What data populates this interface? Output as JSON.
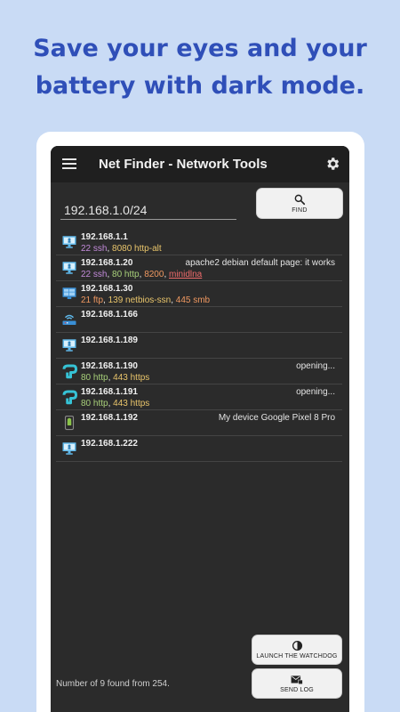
{
  "promo": {
    "line1": "Save your eyes and your",
    "line2": "battery with dark mode."
  },
  "appbar": {
    "title": "Net Finder - Network Tools",
    "menu_icon": "hamburger-menu-icon",
    "settings_icon": "gear-icon"
  },
  "search": {
    "value": "192.168.1.0/24",
    "find_label": "FIND",
    "find_icon": "search-icon"
  },
  "devices": [
    {
      "ip": "192.168.1.1",
      "icon": "monitor-icon",
      "ports": [
        [
          "22 ssh",
          "purple"
        ],
        [
          "8080 http-alt",
          "yellow"
        ]
      ],
      "note": ""
    },
    {
      "ip": "192.168.1.20",
      "icon": "monitor-icon",
      "ports": [
        [
          "22 ssh",
          "purple"
        ],
        [
          "80 http",
          "green"
        ],
        [
          "8200",
          "orange"
        ],
        [
          "minidlna",
          "red"
        ]
      ],
      "note": "apache2 debian default page: it works"
    },
    {
      "ip": "192.168.1.30",
      "icon": "windows-icon",
      "ports": [
        [
          "21 ftp",
          "orange"
        ],
        [
          "139 netbios-ssn",
          "yellow"
        ],
        [
          "445 smb",
          "orange"
        ]
      ],
      "note": ""
    },
    {
      "ip": "192.168.1.166",
      "icon": "router-icon",
      "ports": [],
      "note": ""
    },
    {
      "ip": "192.168.1.189",
      "icon": "monitor-icon",
      "ports": [],
      "note": ""
    },
    {
      "ip": "192.168.1.190",
      "icon": "tplink-icon",
      "ports": [
        [
          "80 http",
          "green"
        ],
        [
          "443 https",
          "yellow"
        ]
      ],
      "note": "opening..."
    },
    {
      "ip": "192.168.1.191",
      "icon": "tplink-icon",
      "ports": [
        [
          "80 http",
          "green"
        ],
        [
          "443 https",
          "yellow"
        ]
      ],
      "note": "opening..."
    },
    {
      "ip": "192.168.1.192",
      "icon": "android-phone-icon",
      "ports": [],
      "note": "My device  Google Pixel 8 Pro"
    },
    {
      "ip": "192.168.1.222",
      "icon": "monitor-icon",
      "ports": [],
      "note": ""
    }
  ],
  "actions": {
    "watchdog_label": "LAUNCH THE WATCHDOG",
    "watchdog_icon": "watchdog-icon",
    "sendlog_label": "SEND LOG",
    "sendlog_icon": "mail-icon"
  },
  "status": "Number of 9 found from 254.",
  "colors": {
    "accent": "#2f4fb8",
    "background": "#c9dbf5",
    "screen": "#2b2b2b",
    "appbar": "#1f1f1f"
  }
}
